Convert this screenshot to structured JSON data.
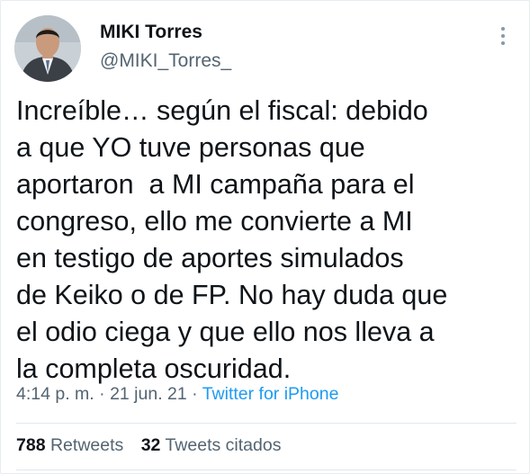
{
  "author": {
    "name": "MIKI Torres",
    "handle": "@MIKI_Torres_"
  },
  "tweet": {
    "lines": [
      "Increíble… según el fiscal: debido",
      "a que YO tuve personas que",
      "aportaron  a MI campaña para el",
      "congreso, ello me convierte a MI",
      "en testigo de aportes simulados",
      "de Keiko o de FP. No hay duda que",
      "el odio ciega y que ello nos lleva a",
      "la completa oscuridad."
    ]
  },
  "meta": {
    "time": "4:14 p. m.",
    "separator": " · ",
    "date": "21 jun. 21",
    "source": "Twitter for iPhone"
  },
  "stats": {
    "retweets_count": "788",
    "retweets_label": "Retweets",
    "quotes_count": "32",
    "quotes_label": "Tweets citados"
  },
  "icons": {
    "more": "more-vertical-icon"
  },
  "colors": {
    "link": "#1d9bf0",
    "secondary_text": "#536471",
    "primary_text": "#0f1419"
  }
}
